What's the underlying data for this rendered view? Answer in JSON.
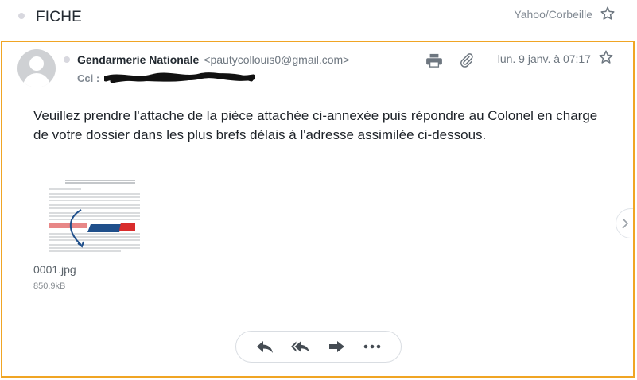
{
  "header": {
    "subject": "FICHE",
    "folder": "Yahoo/Corbeille"
  },
  "message": {
    "sender_name": "Gendarmerie Nationale",
    "sender_email": "<pautycollouis0@gmail.com>",
    "cci_label": "Cci :",
    "date": "lun. 9 janv. à 07:17",
    "body": "Veuillez prendre l'attache de la pièce attachée ci-annexée puis répondre au Colonel en charge de votre dossier dans les plus brefs délais à l'adresse assimilée ci-dessous."
  },
  "attachment": {
    "filename": "0001.jpg",
    "size": "850.9kB"
  },
  "icons": {
    "star": "star-outline-icon",
    "print": "print-icon",
    "attachment": "paperclip-icon",
    "reply": "reply-icon",
    "reply_all": "reply-all-icon",
    "forward": "forward-icon",
    "more": "more-icon",
    "next": "chevron-right-icon"
  },
  "colors": {
    "selected_border": "#f0a524",
    "icon_gray": "#6e7780"
  }
}
